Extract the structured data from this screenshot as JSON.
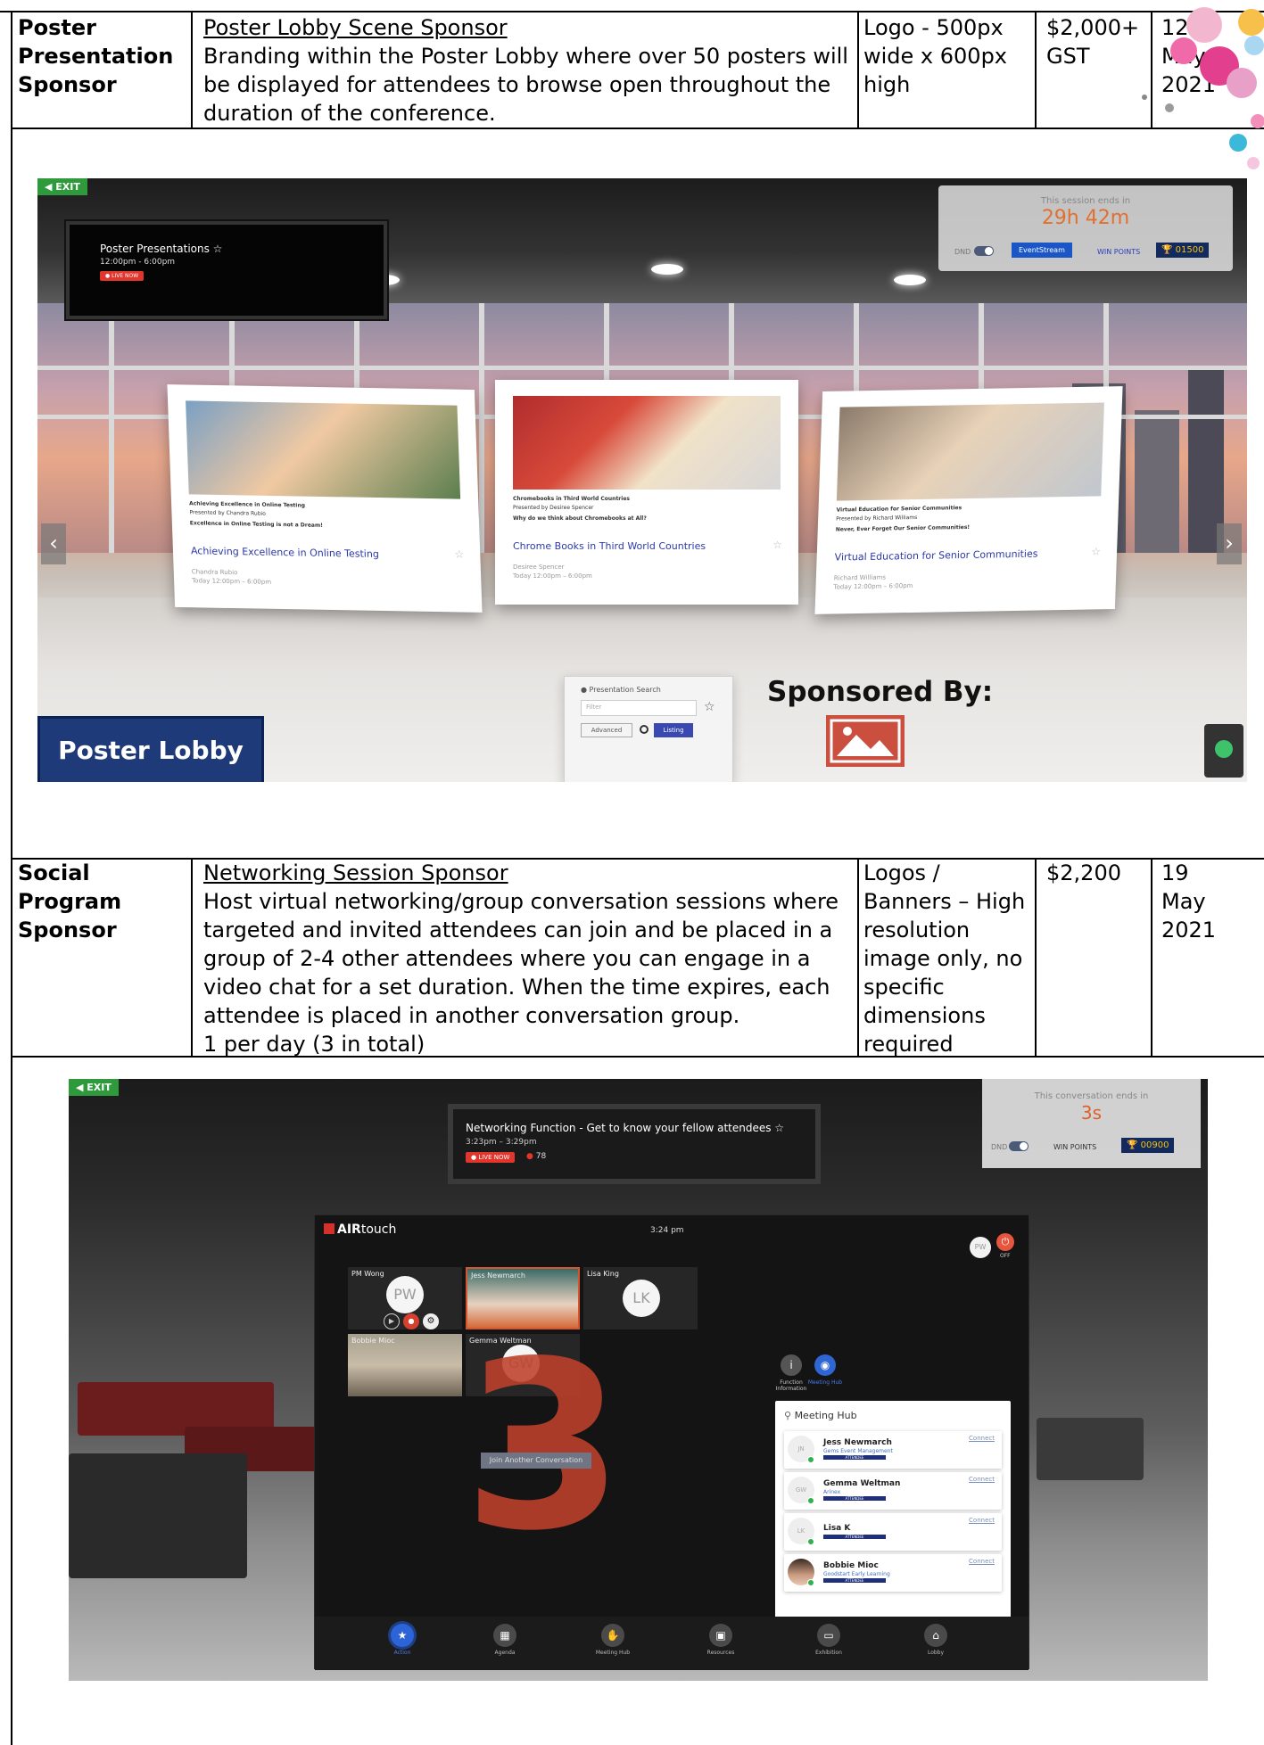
{
  "table_top": {
    "item": "Poster Presentation Sponsor",
    "title": "Poster Lobby Scene Sponsor",
    "description": "Branding within the Poster Lobby where over 50 posters will be displayed for attendees to browse open throughout the duration of the conference.",
    "specs": "Logo - 500px wide x 600px high",
    "price": "$2,000+ GST",
    "deadline": "12 May 2021"
  },
  "table_bottom": {
    "item": "Social Program Sponsor",
    "title": "Networking Session Sponsor",
    "description": "Host virtual networking/group conversation sessions where targeted and invited attendees can join and be placed in a group of 2-4 other attendees where you can engage in a video chat for a set duration. When the time expires, each attendee is placed in another conversation group.",
    "note": "1 per day (3 in total)",
    "specs": "Logos / Banners – High resolution image only, no specific dimensions required",
    "price": "$2,200",
    "deadline": "19 May 2021"
  },
  "poster_lobby": {
    "exit": "EXIT",
    "screen_title": "Poster Presentations ☆",
    "screen_time": "12:00pm - 6:00pm",
    "live": "● LIVE NOW",
    "session_ends": "This session ends in",
    "session_timer": "29h 42m",
    "dnd": "DND",
    "eventstream": "EventStream",
    "win_points": "WIN POINTS",
    "points": "🏆 01500",
    "posters": [
      {
        "small_title": "Achieving Excellence in Online Testing",
        "presenter": "Presented by Chandra Rubio",
        "line": "Excellence in Online Testing is not a Dream!",
        "title": "Achieving Excellence in Online Testing",
        "author": "Chandra Rubio",
        "time": "Today 12:00pm – 6:00pm"
      },
      {
        "small_title": "Chromebooks in Third World Countries",
        "presenter": "Presented by Desiree Spencer",
        "line": "Why do we think about Chromebooks at All?",
        "title": "Chrome Books in Third World Countries",
        "author": "Desiree Spencer",
        "time": "Today 12:00pm – 6:00pm"
      },
      {
        "small_title": "Virtual Education for Senior Communities",
        "presenter": "Presented by Richard Williams",
        "line": "Never, Ever Forget Our Senior Communities!",
        "title": "Virtual Education for Senior Communities",
        "author": "Richard Williams",
        "time": "Today 12:00pm – 6:00pm"
      }
    ],
    "search_title": "Presentation Search",
    "filter_placeholder": "Filter",
    "advanced": "Advanced",
    "listing": "Listing",
    "sponsored_by": "Sponsored By:",
    "lobby_label": "Poster Lobby",
    "power": "ON"
  },
  "networking": {
    "exit": "EXIT",
    "screen_title": "Networking Function - Get to know your fellow attendees ☆",
    "screen_time": "3:23pm – 3:29pm",
    "live": "● LIVE NOW",
    "attendees": "78",
    "conv_ends": "This conversation ends in",
    "conv_timer": "3s",
    "dnd": "DND",
    "win_points": "WIN POINTS",
    "points": "🏆 00900",
    "app_name_bold": "AIR",
    "app_name": "touch",
    "clock": "3:24 pm",
    "user_initials": "PW",
    "off": "OFF",
    "tiles": [
      {
        "name": "PM Wong",
        "initials": "PW"
      },
      {
        "name": "Jess Newmarch",
        "initials": ""
      },
      {
        "name": "Lisa King",
        "initials": "LK"
      },
      {
        "name": "Bobbie Mioc",
        "initials": ""
      },
      {
        "name": "Gemma Weltman",
        "initials": "GW"
      }
    ],
    "countdown": "3",
    "join_another": "Join Another Conversation",
    "function_info": "Function Information",
    "meeting_hub_tab": "Meeting Hub",
    "hub_title": "Meeting Hub",
    "hub_people": [
      {
        "initials": "JN",
        "name": "Jess Newmarch",
        "org": "Gems Event Management",
        "role": "ATTENDEE",
        "action": "Connect"
      },
      {
        "initials": "GW",
        "name": "Gemma Weltman",
        "org": "Arinex",
        "role": "ATTENDEE",
        "action": "Connect"
      },
      {
        "initials": "LK",
        "name": "Lisa K",
        "org": "",
        "role": "ATTENDEE",
        "action": "Connect"
      },
      {
        "initials": "",
        "name": "Bobbie Mioc",
        "org": "Goodstart Early Learning",
        "role": "ATTENDEE",
        "action": "Connect"
      }
    ],
    "nav": [
      {
        "label": "Action",
        "icon": "★"
      },
      {
        "label": "Agenda",
        "icon": "▦"
      },
      {
        "label": "Meeting Hub",
        "icon": "✋"
      },
      {
        "label": "Resources",
        "icon": "▣"
      },
      {
        "label": "Exhibition",
        "icon": "▭"
      },
      {
        "label": "Lobby",
        "icon": "⌂"
      }
    ]
  }
}
